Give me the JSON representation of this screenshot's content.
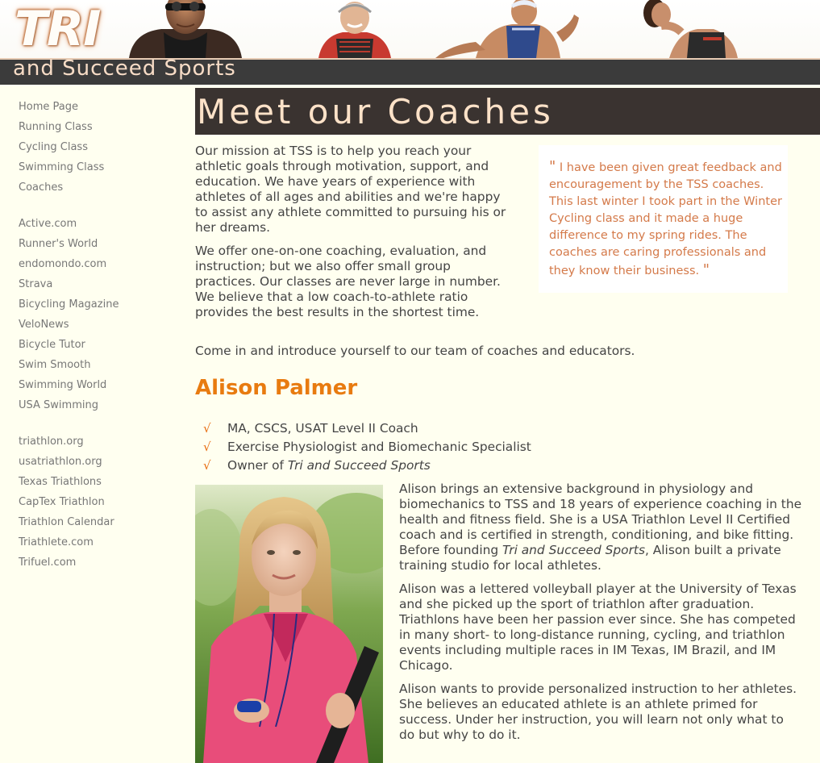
{
  "header": {
    "logo_text": "TRI",
    "site_name": "and Succeed Sports"
  },
  "sidebar": {
    "groups": [
      [
        "Home Page",
        "Running Class",
        "Cycling Class",
        "Swimming Class",
        "Coaches"
      ],
      [
        "Active.com",
        "Runner's World",
        "endomondo.com",
        "Strava",
        "Bicycling Magazine",
        "VeloNews",
        "Bicycle Tutor",
        "Swim Smooth",
        "Swimming World",
        "USA Swimming"
      ],
      [
        "triathlon.org",
        "usatriathlon.org",
        "Texas Triathlons",
        "CapTex Triathlon",
        "Triathlon Calendar",
        "Triathlete.com",
        "Trifuel.com"
      ]
    ]
  },
  "main": {
    "title": "Meet our Coaches",
    "intro": [
      "Our mission at TSS is to help you reach your athletic goals through motivation, support, and education. We have years of experience with athletes of all ages and abilities and we're happy to assist any athlete committed to pursuing his or her dreams.",
      "We offer one-on-one coaching, evaluation, and instruction; but we also offer small group practices. Our classes are never large in number. We believe that a low coach-to-athlete ratio provides the best results in the shortest time.",
      "Come in and introduce yourself to our team of coaches and educators."
    ],
    "quote": "I have been given great feedback and encouragement by the TSS coaches. This last winter I took part in the Winter Cycling class and it made a huge difference to my spring rides. The coaches are caring professionals and they know their business.",
    "coach": {
      "name": "Alison Palmer",
      "credentials": [
        "MA, CSCS, USAT Level II Coach",
        "Exercise Physiologist and Biomechanic Specialist",
        "Owner of "
      ],
      "owner_business": "Tri and Succeed Sports",
      "bio1_before": "Alison brings an extensive background in physiology and biomechanics to TSS and 18 years of experience coaching in the health and fitness field. She is a USA Triathlon Level II Certified coach and is certified in strength, conditioning, and bike fitting. Before founding ",
      "bio1_business": "Tri and Succeed Sports",
      "bio1_after": ", Alison built a private training studio for local athletes.",
      "bio2": "Alison was a lettered volleyball player at the University of Texas and she picked up the sport of triathlon after graduation. Triathlons have been her passion ever since. She has competed in many short- to long-distance running, cycling, and triathlon events including multiple races in IM Texas, IM Brazil, and IM Chicago.",
      "bio3": "Alison wants to provide personalized instruction to her athletes. She believes an educated athlete is an athlete primed for success. Under her instruction, you will learn not only what to do but why to do it."
    }
  },
  "colors": {
    "page_bg": "#fffff0",
    "title_bar": "#3a3330",
    "title_text": "#fde2c8",
    "coach_name": "#e87b10",
    "quote_text": "#d47a4a",
    "check": "#e86d10"
  }
}
